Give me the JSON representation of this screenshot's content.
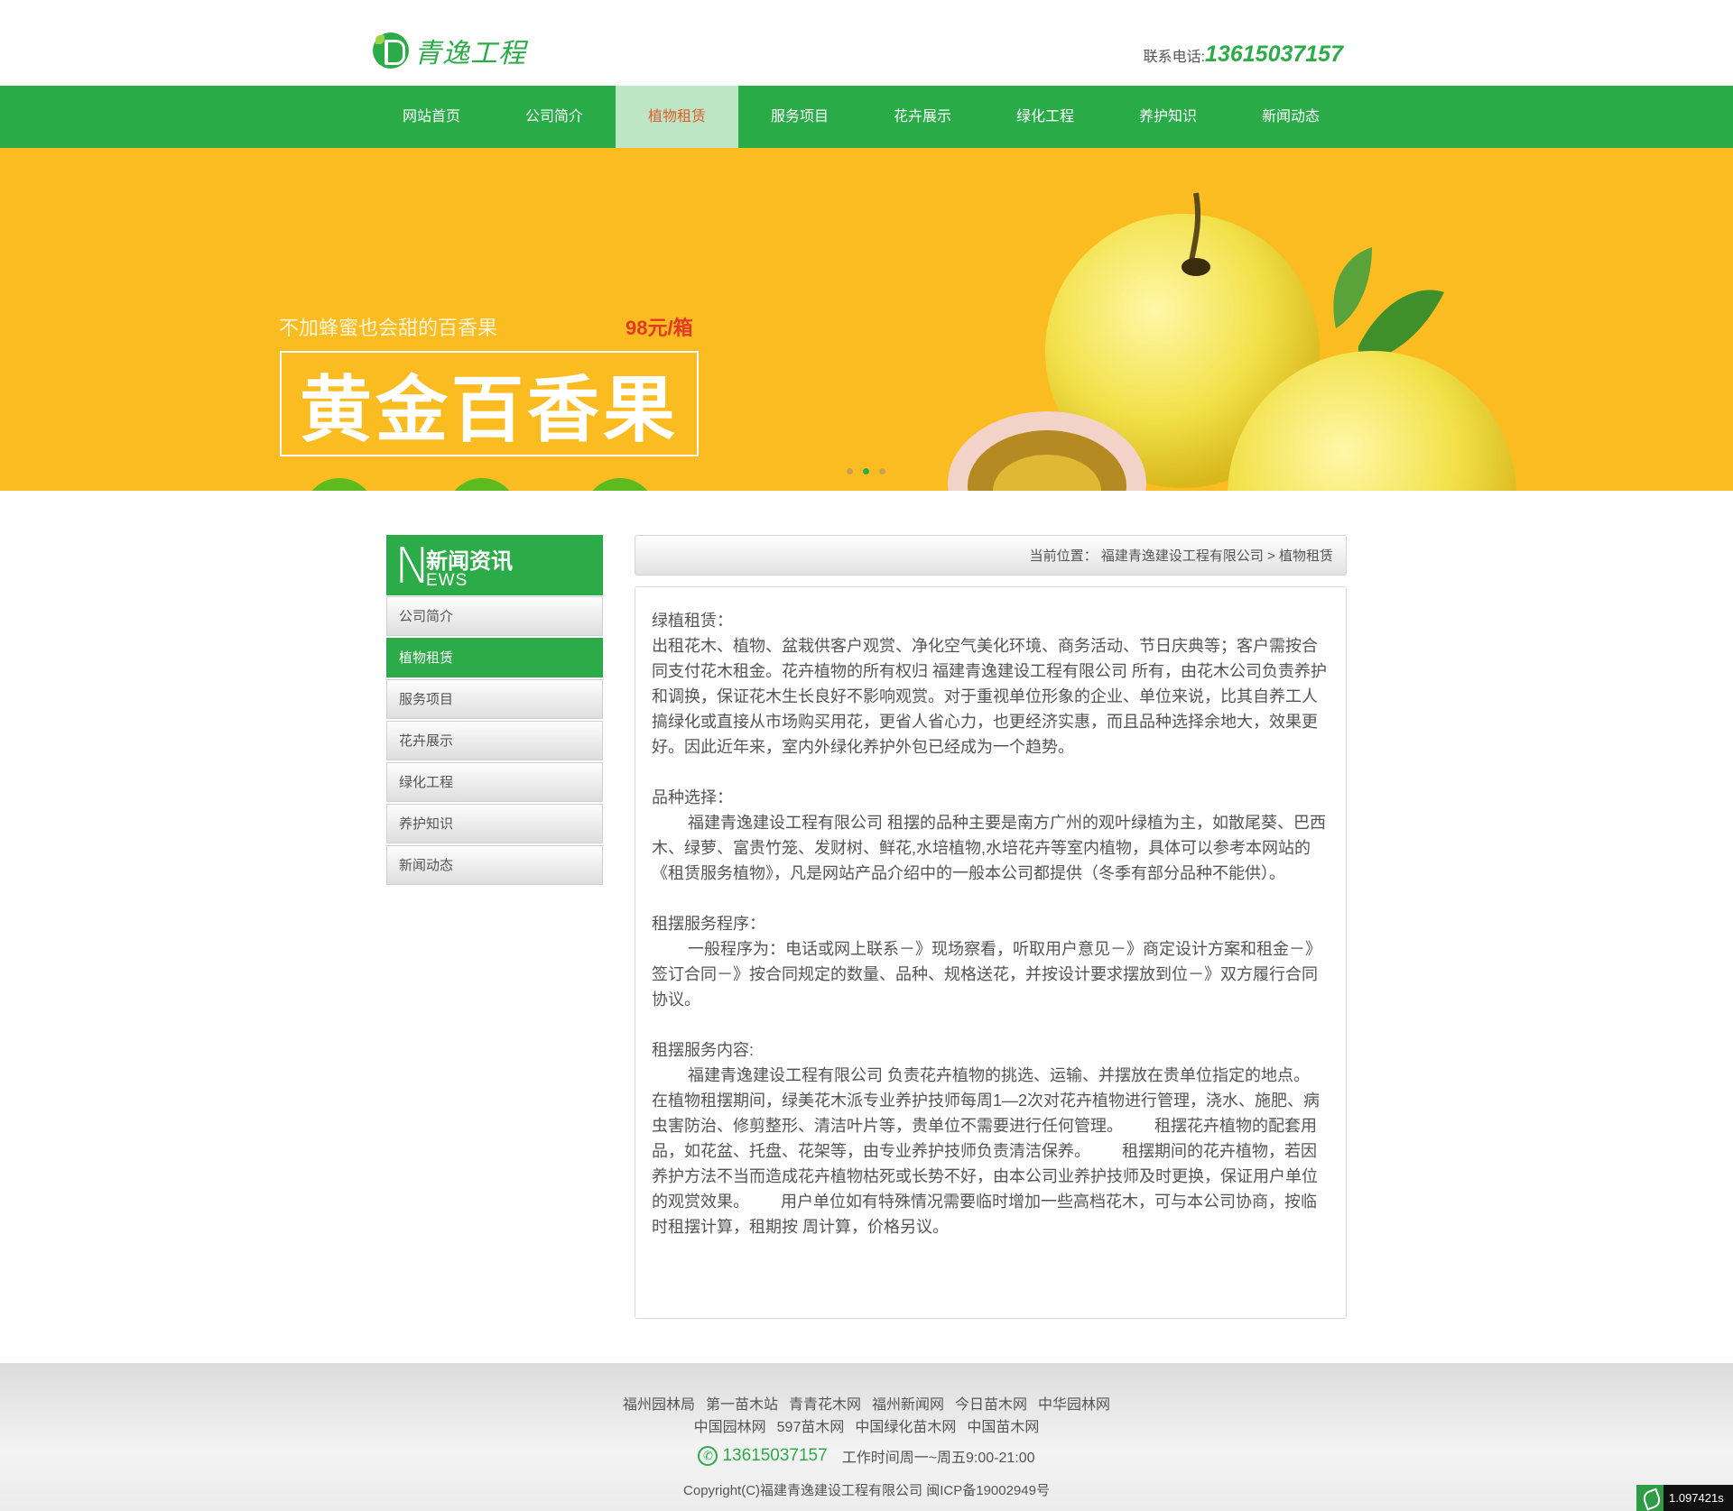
{
  "header": {
    "logo_text": "青逸工程",
    "contact_label": "联系电话:",
    "contact_phone": "13615037157"
  },
  "nav": {
    "items": [
      {
        "label": "网站首页"
      },
      {
        "label": "公司简介"
      },
      {
        "label": "植物租赁"
      },
      {
        "label": "服务项目"
      },
      {
        "label": "花卉展示"
      },
      {
        "label": "绿化工程"
      },
      {
        "label": "养护知识"
      },
      {
        "label": "新闻动态"
      }
    ],
    "active": "植物租赁",
    "colors": {
      "bar": "#29ac48",
      "active_bg": "#bde6c7",
      "active_text": "#e25c2c"
    }
  },
  "banner": {
    "subtitle": "不加蜂蜜也会甜的百香果",
    "price": "98元/箱",
    "headline": "黄金百香果",
    "slide_count": 3,
    "active_slide": 2,
    "background": "#fbbc21"
  },
  "sidebar": {
    "heading_letter": "N",
    "heading_cn": "新闻资讯",
    "heading_en": "EWS",
    "items": [
      {
        "label": "公司简介"
      },
      {
        "label": "植物租赁"
      },
      {
        "label": "服务项目"
      },
      {
        "label": "花卉展示"
      },
      {
        "label": "绿化工程"
      },
      {
        "label": "养护知识"
      },
      {
        "label": "新闻动态"
      }
    ],
    "active": "植物租赁"
  },
  "breadcrumb": {
    "label": "当前位置：",
    "home": "福建青逸建设工程有限公司",
    "sep": ">",
    "current": "植物租赁"
  },
  "article": {
    "s1_title": "绿植租赁：",
    "s1_body": "出租花木、植物、盆栽供客户观赏、净化空气美化环境、商务活动、节日庆典等；客户需按合同支付花木租金。花卉植物的所有权归 福建青逸建设工程有限公司 所有，由花木公司负责养护和调换，保证花木生长良好不影响观赏。对于重视单位形象的企业、单位来说，比其自养工人搞绿化或直接从市场购买用花，更省人省心力，也更经济实惠，而且品种选择余地大，效果更好。因此近年来，室内外绿化养护外包已经成为一个趋势。",
    "s2_title": "品种选择：",
    "s2_body": "福建青逸建设工程有限公司 租摆的品种主要是南方广州的观叶绿植为主，如散尾葵、巴西木、绿萝、富贵竹笼、发财树、鲜花,水培植物,水培花卉等室内植物，具体可以参考本网站的《租赁服务植物》，凡是网站产品介绍中的一般本公司都提供（冬季有部分品种不能供）。",
    "s3_title": "租摆服务程序：",
    "s3_body": "一般程序为：电话或网上联系－》现场察看，听取用户意见－》商定设计方案和租金－》签订合同－》按合同规定的数量、品种、规格送花，并按设计要求摆放到位－》双方履行合同协议。",
    "s4_title": "租摆服务内容:",
    "s4_body": "福建青逸建设工程有限公司 负责花卉植物的挑选、运输、并摆放在贵单位指定的地点。 在植物租摆期间，绿美花木派专业养护技师每周1—2次对花卉植物进行管理，浇水、施肥、病虫害防治、修剪整形、清洁叶片等，贵单位不需要进行任何管理。       租摆花卉植物的配套用品，如花盆、托盘、花架等，由专业养护技师负责清洁保养。       租摆期间的花卉植物，若因养护方法不当而造成花卉植物枯死或长势不好，由本公司业养护技师及时更换，保证用户单位的观赏效果。       用户单位如有特殊情况需要临时增加一些高档花木，可与本公司协商，按临时租摆计算，租期按 周计算，价格另议。"
  },
  "footer": {
    "links_row1": [
      "福州园林局",
      "第一苗木站",
      "青青花木网",
      "福州新闻网",
      "今日苗木网",
      "中华园林网"
    ],
    "links_row2": [
      "中国园林网",
      "597苗木网",
      "中国绿化苗木网",
      "中国苗木网"
    ],
    "phone": "13615037157",
    "hours": "工作时间周一~周五9:00-21:00",
    "copyright": "Copyright(C)福建青逸建设工程有限公司 闽ICP备19002949号"
  },
  "timer": {
    "value": "1.097421s"
  }
}
